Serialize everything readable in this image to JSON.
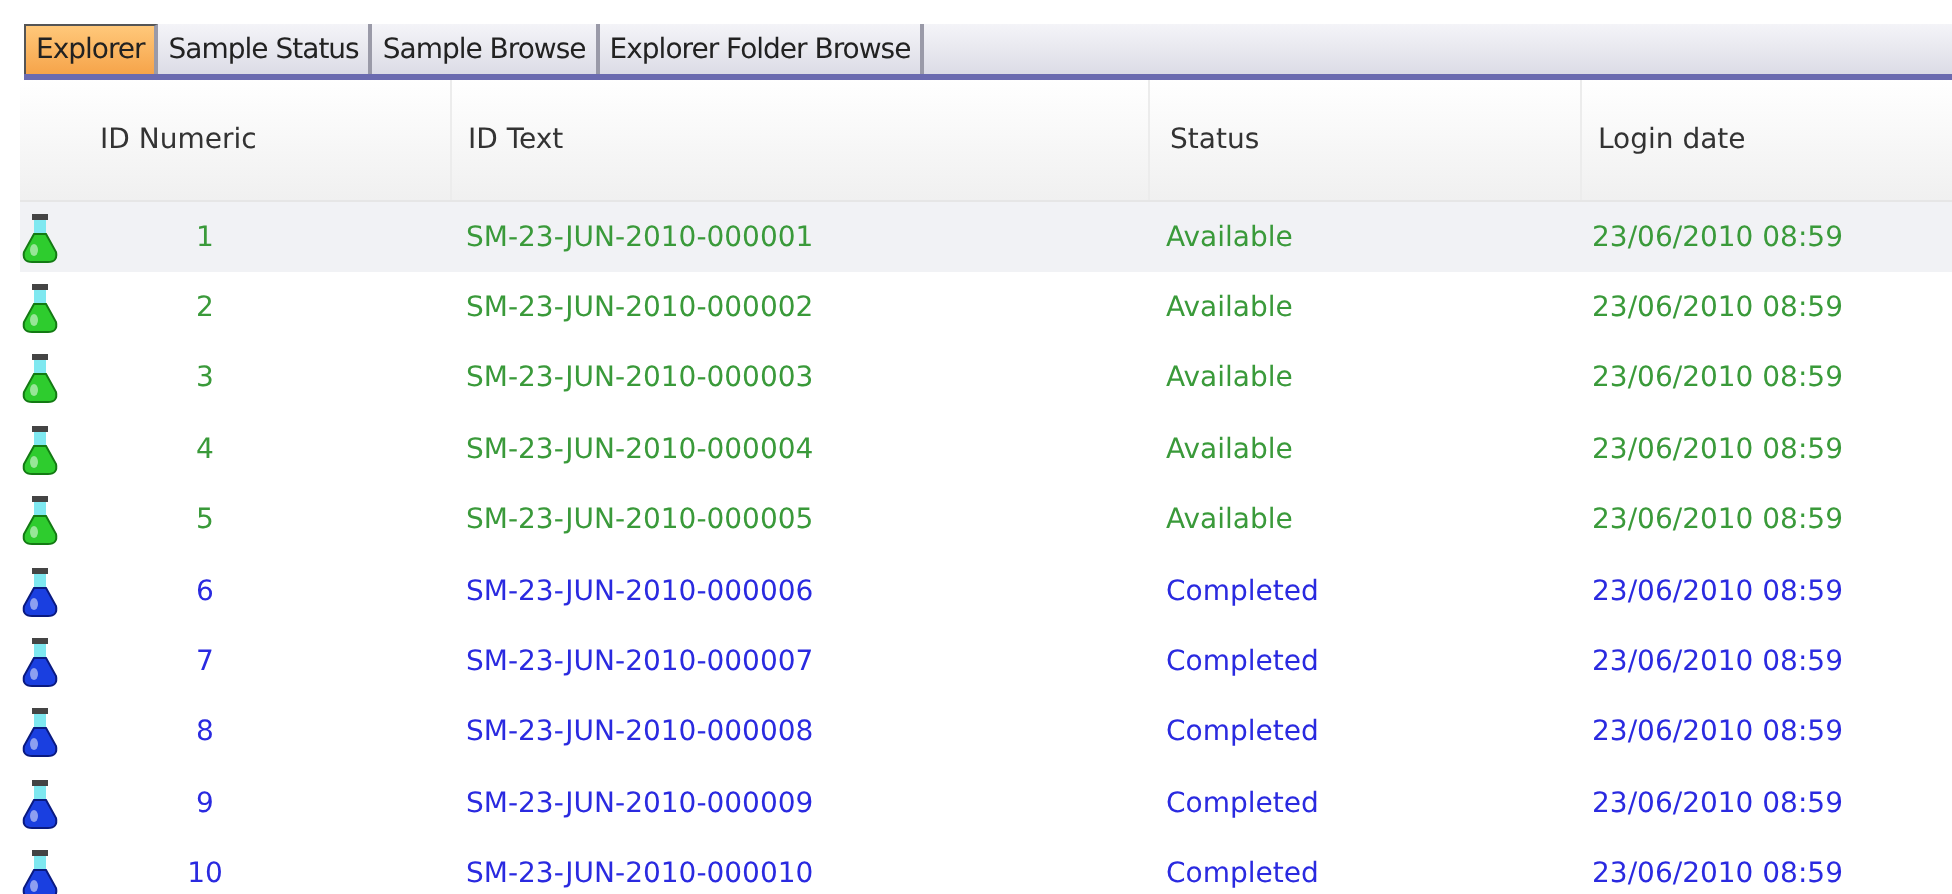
{
  "tabs": [
    {
      "label": "Explorer",
      "selected": true
    },
    {
      "label": "Sample Status",
      "selected": false
    },
    {
      "label": "Sample Browse",
      "selected": false
    },
    {
      "label": "Explorer Folder Browse",
      "selected": false
    }
  ],
  "table": {
    "columns": [
      "ID Numeric",
      "ID Text",
      "Status",
      "Login date"
    ],
    "rows": [
      {
        "kind": "available",
        "selected": true,
        "cells": [
          "1",
          "SM-23-JUN-2010-000001",
          "Available",
          "23/06/2010 08:59"
        ]
      },
      {
        "kind": "available",
        "selected": false,
        "cells": [
          "2",
          "SM-23-JUN-2010-000002",
          "Available",
          "23/06/2010 08:59"
        ]
      },
      {
        "kind": "available",
        "selected": false,
        "cells": [
          "3",
          "SM-23-JUN-2010-000003",
          "Available",
          "23/06/2010 08:59"
        ]
      },
      {
        "kind": "available",
        "selected": false,
        "cells": [
          "4",
          "SM-23-JUN-2010-000004",
          "Available",
          "23/06/2010 08:59"
        ]
      },
      {
        "kind": "available",
        "selected": false,
        "cells": [
          "5",
          "SM-23-JUN-2010-000005",
          "Available",
          "23/06/2010 08:59"
        ]
      },
      {
        "kind": "completed",
        "selected": false,
        "cells": [
          "6",
          "SM-23-JUN-2010-000006",
          "Completed",
          "23/06/2010 08:59"
        ]
      },
      {
        "kind": "completed",
        "selected": false,
        "cells": [
          "7",
          "SM-23-JUN-2010-000007",
          "Completed",
          "23/06/2010 08:59"
        ]
      },
      {
        "kind": "completed",
        "selected": false,
        "cells": [
          "8",
          "SM-23-JUN-2010-000008",
          "Completed",
          "23/06/2010 08:59"
        ]
      },
      {
        "kind": "completed",
        "selected": false,
        "cells": [
          "9",
          "SM-23-JUN-2010-000009",
          "Completed",
          "23/06/2010 08:59"
        ]
      },
      {
        "kind": "completed",
        "selected": false,
        "cells": [
          "10",
          "SM-23-JUN-2010-000010",
          "Completed",
          "23/06/2010 08:59"
        ]
      }
    ]
  }
}
